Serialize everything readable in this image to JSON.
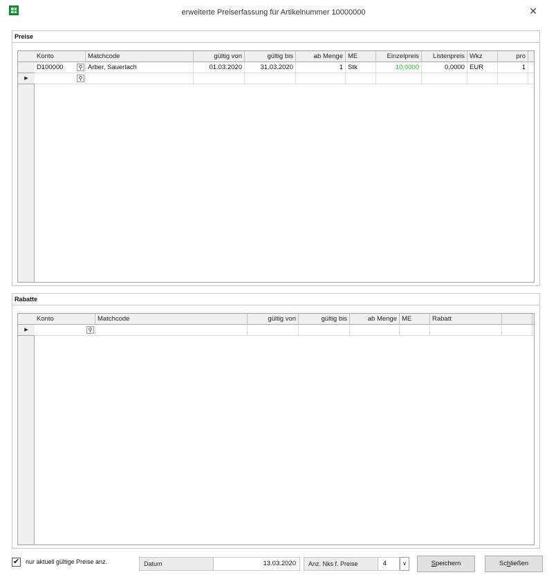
{
  "window": {
    "title": "erweiterte Preiserfassung für Artikelnummer  10000000",
    "close_glyph": "✕"
  },
  "preise": {
    "group_title": "Preise",
    "columns": [
      {
        "label": "Konto",
        "align": "l"
      },
      {
        "label": "Matchcode",
        "align": "l"
      },
      {
        "label": "gültig von",
        "align": "r"
      },
      {
        "label": "gültig bis",
        "align": "r"
      },
      {
        "label": "ab Menge",
        "align": "r"
      },
      {
        "label": "ME",
        "align": "l"
      },
      {
        "label": "Einzelpreis",
        "align": "r"
      },
      {
        "label": "Listenpreis",
        "align": "r"
      },
      {
        "label": "Wkz",
        "align": "l"
      },
      {
        "label": "pro",
        "align": "r"
      }
    ],
    "rows": [
      {
        "konto": "D100000",
        "matchcode": "Arber, Sauerlach",
        "gueltig_von": "01.03.2020",
        "gueltig_bis": "31.03.2020",
        "ab_menge": "1",
        "me": "Stk",
        "einzelpreis": "10,0000",
        "listenpreis": "0,0000",
        "wkz": "EUR",
        "pro": "1"
      }
    ],
    "new_row_marker": "▶",
    "einzelpreis_color": "#2ec02e"
  },
  "rabatte": {
    "group_title": "Rabatte",
    "columns": [
      {
        "label": "Konto",
        "align": "l"
      },
      {
        "label": "Matchcode",
        "align": "l"
      },
      {
        "label": "gültig von",
        "align": "r"
      },
      {
        "label": "gültig bis",
        "align": "r"
      },
      {
        "label": "ab Menge",
        "align": "r"
      },
      {
        "label": "ME",
        "align": "l"
      },
      {
        "label": "Rabatt",
        "align": "l"
      },
      {
        "label": "",
        "align": "l"
      }
    ],
    "new_row_marker": "▶"
  },
  "footer": {
    "checkbox_checked": true,
    "checkbox_glyph": "✔",
    "checkbox_label": "nur aktuell gültige Preise anz.",
    "datum_label": "Datum",
    "datum_value": "13.03.2020",
    "nks_label": "Anz. Nks f. Preise",
    "nks_value": "4",
    "nks_spin_glyph": "∨",
    "save_label_first": "S",
    "save_label_rest": "peichern",
    "close_label_pre": "Sc",
    "close_label_u": "h",
    "close_label_rest": "ließen"
  },
  "icons": {
    "lookup": "magnifier-icon",
    "app": "app-grid-icon"
  }
}
